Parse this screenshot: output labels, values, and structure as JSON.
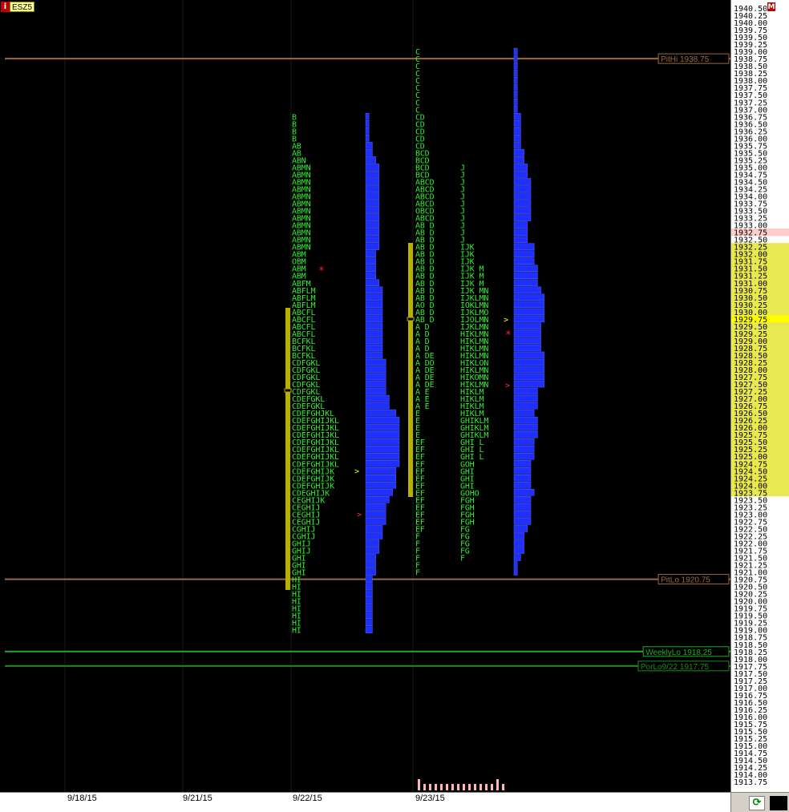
{
  "symbol": {
    "badge": "i",
    "name": "ESZ5"
  },
  "menu_badge": "M",
  "dates": [
    "9/18/15",
    "9/21/15",
    "9/22/15",
    "9/23/15"
  ],
  "refresh_glyph": "⟳",
  "colors": {
    "tpo": "#33ee33",
    "profile": "#1f2fff",
    "value_area": "#b8b000",
    "pit": "#9a6a40",
    "weekly": "#22aa22",
    "price_highlight": "#ffcccc",
    "price_value_area": "#e8e850",
    "current_price": "#ffff00"
  },
  "price_scale": {
    "high": 1940.5,
    "low": 1913.75,
    "step": 0.25
  },
  "highlighted_price": "1932.75",
  "current_price": "1929.75",
  "value_area_prices": {
    "high": 1932.25,
    "low": 1923.75
  },
  "levels": [
    {
      "label": "PitHi 1938.75",
      "price": 1938.75,
      "kind": "pit"
    },
    {
      "label": "PitLo 1920.75",
      "price": 1920.75,
      "kind": "pit"
    },
    {
      "label": "WeeklyLo 1918.25",
      "price": 1918.25,
      "kind": "weekly"
    },
    {
      "label": "PorLo9/22 1917.75",
      "price": 1917.75,
      "kind": "weekly2"
    }
  ],
  "profiles": [
    {
      "day": "9/22/15",
      "high": 1936.75,
      "tpo_rows": [
        "B",
        "B",
        "B",
        "B",
        "AB",
        "AB",
        "ABN",
        "ABMN",
        "ABMN",
        "ABMN",
        "ABMN",
        "ABMN",
        "ABMN",
        "ABMN",
        "ABMN",
        "ABMN",
        "ABMN",
        "ABMN",
        "ABMN",
        "ABM",
        "OBM",
        "ABM",
        "ABM",
        "ABFM",
        "ABFLM",
        "ABFLM",
        "ABFLM",
        "ABCFL",
        "ABCFL",
        "ABCFL",
        "ABCFL",
        "BCFKL",
        "BCFKL",
        "BCFKL",
        "CDFGKL",
        "CDFGKL",
        "CDFGKL",
        "CDFGKL",
        "CDFGKL",
        "CDEFGKL",
        "CDEFGKL",
        "CDEFGHJKL",
        "CDEFGHIJKL",
        "CDEFGHIJKL",
        "CDEFGHIJKL",
        "CDEFGHIJKL",
        "CDEFGHIJKL",
        "CDEFGHIJKL",
        "CDEFGHIJKL",
        "CDEFGHIJK",
        "CDEFGHIJK",
        "CDEFGHIJK",
        "CDEGHIJK",
        "CEGHIJK",
        "CEGHIJ",
        "CEGHIJ",
        "CEGHIJ",
        "CGHIJ",
        "CGHIJ",
        "GHIJ",
        "GHIJ",
        "GHI",
        "GHI",
        "GHI",
        "HI",
        "HI",
        "HI",
        "HI",
        "HI",
        "HI",
        "HI",
        "HI"
      ]
    },
    {
      "day": "9/23/15 AM",
      "high": 1939.0,
      "tpo_rows": [
        "C",
        "C",
        "C",
        "C",
        "C",
        "C",
        "C",
        "C",
        "C",
        "CD",
        "CD",
        "CD",
        "CD",
        "CD",
        "BCD",
        "BCD",
        "BCD",
        "BCD",
        "ABCD",
        "ABCD",
        "ABCD",
        "ABCD",
        "OBCD",
        "ABCD",
        "AB D",
        "AB D",
        "AB D",
        "AB D",
        "AB D",
        "AB D",
        "AB D",
        "AB D",
        "AB D",
        "AB D",
        "AB D",
        "AO D",
        "AB D",
        "AB D",
        "A D",
        "A D",
        "A D",
        "A D",
        "A DE",
        "A DO",
        "A DE",
        "A DE",
        "A DE",
        "A E",
        "A E",
        "A E",
        "E",
        "E",
        "E",
        "E",
        "EF",
        "EF",
        "EF",
        "EF",
        "EF",
        "EF",
        "EF",
        "EF",
        "EF",
        "EF",
        "EF",
        "EF",
        "EF",
        "F",
        "F",
        "F",
        "F",
        "F",
        "F"
      ]
    },
    {
      "day": "9/23/15 PM",
      "high": 1935.0,
      "tpo_rows": [
        "J",
        "J",
        "J",
        "J",
        "J",
        "J",
        "J",
        "J",
        "J",
        "J",
        "J",
        "IJK",
        "IJK",
        "IJK",
        "IJK M",
        "IJK M",
        "IJK M",
        "IJK MN",
        "IJKLMN",
        "IOKLMN",
        "IJKLMO",
        "IJOLMN",
        "IJKLMN",
        "HIKLMN",
        "HIKLMN",
        "HIKLMN",
        "HIKLMN",
        "HIKLON",
        "HIKLMN",
        "HIKOMN",
        "HIKLMN",
        "HIKLM",
        "HIKLM",
        "HIKLM",
        "HIKLM",
        "GHIKLM",
        "GHIKLM",
        "GHIKLM",
        "GHI L",
        "GHI L",
        "GHI L",
        "GOH",
        "GHI",
        "GHI",
        "GHI",
        "GOHO",
        "FGH",
        "FGH",
        "FGH",
        "FGH",
        "FG",
        "FG",
        "FG",
        "FG",
        "F"
      ]
    }
  ]
}
